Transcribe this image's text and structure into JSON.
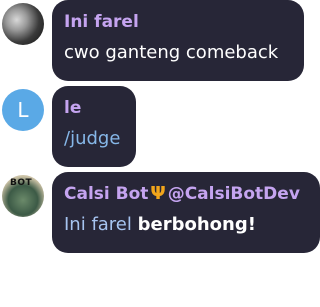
{
  "messages": [
    {
      "name": "Ini farel",
      "text": "cwo ganteng comeback"
    },
    {
      "name": "le",
      "avatar_letter": "L",
      "text": "/judge"
    },
    {
      "name": "Calsi Bot",
      "handle": "@CalsiBotDev",
      "text_plain": "Ini farel",
      "text_bold": "berbohong!",
      "avatar_label": "BOT"
    }
  ],
  "colors": {
    "bubble_bg": "#272637",
    "name": "#c5a4f0",
    "avatar_blue": "#5aa9e6",
    "trident": "#f2a51b"
  },
  "icons": {
    "bot_badge": "trident-icon"
  }
}
